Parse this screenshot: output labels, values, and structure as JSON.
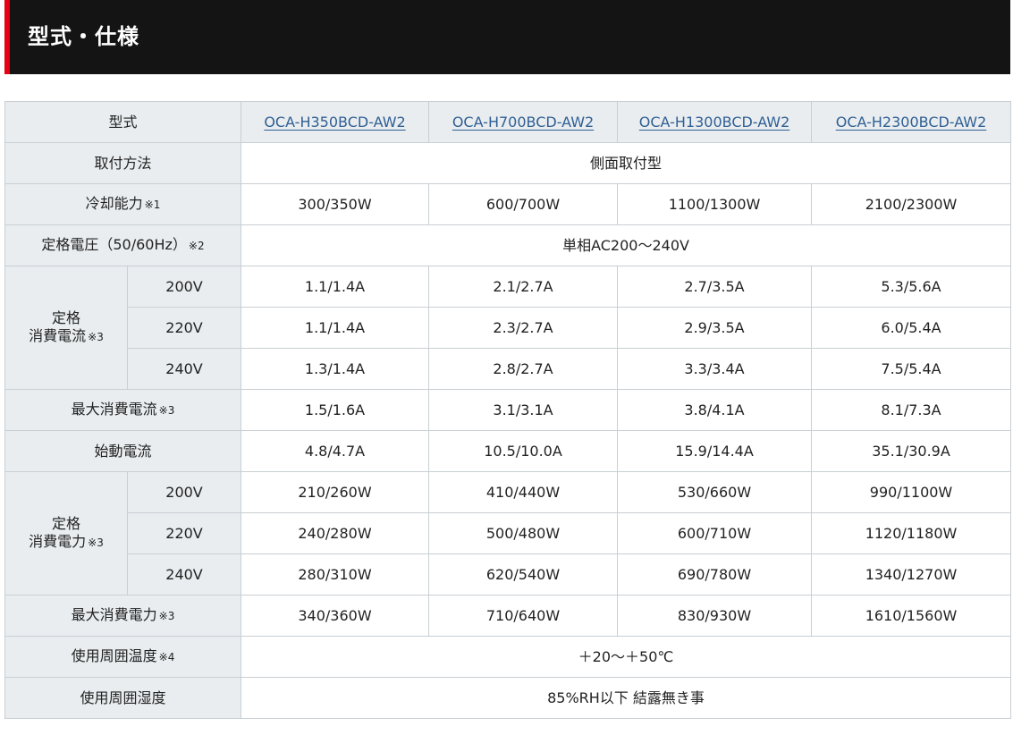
{
  "section": {
    "title": "型式・仕様"
  },
  "table": {
    "model_label": "型式",
    "models": [
      "OCA-H350BCD-AW2",
      "OCA-H700BCD-AW2",
      "OCA-H1300BCD-AW2",
      "OCA-H2300BCD-AW2"
    ],
    "mounting": {
      "label": "取付方法",
      "value": "側面取付型"
    },
    "cooling_capacity": {
      "label": "冷却能力",
      "note": "※1",
      "values": [
        "300/350W",
        "600/700W",
        "1100/1300W",
        "2100/2300W"
      ]
    },
    "rated_voltage": {
      "label": "定格電圧（50/60Hz）",
      "note": "※2",
      "value": "単相AC200〜240V"
    },
    "rated_current": {
      "label_line1": "定格",
      "label_line2": "消費電流",
      "note": "※3",
      "rows": [
        {
          "voltage": "200V",
          "values": [
            "1.1/1.4A",
            "2.1/2.7A",
            "2.7/3.5A",
            "5.3/5.6A"
          ]
        },
        {
          "voltage": "220V",
          "values": [
            "1.1/1.4A",
            "2.3/2.7A",
            "2.9/3.5A",
            "6.0/5.4A"
          ]
        },
        {
          "voltage": "240V",
          "values": [
            "1.3/1.4A",
            "2.8/2.7A",
            "3.3/3.4A",
            "7.5/5.4A"
          ]
        }
      ]
    },
    "max_current": {
      "label": "最大消費電流",
      "note": "※3",
      "values": [
        "1.5/1.6A",
        "3.1/3.1A",
        "3.8/4.1A",
        "8.1/7.3A"
      ]
    },
    "starting_current": {
      "label": "始動電流",
      "values": [
        "4.8/4.7A",
        "10.5/10.0A",
        "15.9/14.4A",
        "35.1/30.9A"
      ]
    },
    "rated_power": {
      "label_line1": "定格",
      "label_line2": "消費電力",
      "note": "※3",
      "rows": [
        {
          "voltage": "200V",
          "values": [
            "210/260W",
            "410/440W",
            "530/660W",
            "990/1100W"
          ]
        },
        {
          "voltage": "220V",
          "values": [
            "240/280W",
            "500/480W",
            "600/710W",
            "1120/1180W"
          ]
        },
        {
          "voltage": "240V",
          "values": [
            "280/310W",
            "620/540W",
            "690/780W",
            "1340/1270W"
          ]
        }
      ]
    },
    "max_power": {
      "label": "最大消費電力",
      "note": "※3",
      "values": [
        "340/360W",
        "710/640W",
        "830/930W",
        "1610/1560W"
      ]
    },
    "ambient_temp": {
      "label": "使用周囲温度",
      "note": "※4",
      "value": "＋20〜＋50℃"
    },
    "ambient_humidity": {
      "label": "使用周囲湿度",
      "value": "85%RH以下 結露無き事"
    }
  }
}
